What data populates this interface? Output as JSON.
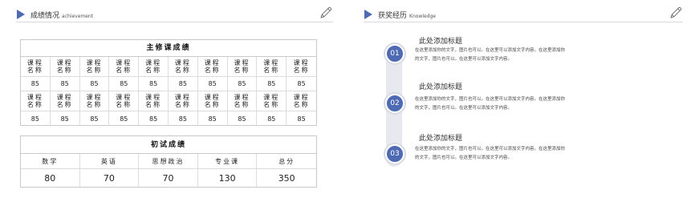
{
  "left": {
    "header": {
      "title": "成绩情况",
      "subtitle": "achievement",
      "icon": "pen-icon"
    },
    "major_table": {
      "title": "主修课成绩",
      "header_row_1": [
        "课程\n名称",
        "课程\n名称",
        "课程\n名称",
        "课程\n名称",
        "课程\n名称",
        "课程\n名称",
        "课程\n名称",
        "课程\n名称",
        "课程\n名称",
        "课程\n名称"
      ],
      "score_row_1": [
        "85",
        "85",
        "85",
        "85",
        "85",
        "85",
        "85",
        "85",
        "85",
        "85"
      ],
      "header_row_2": [
        "课程\n名称",
        "课程\n名称",
        "课程\n名称",
        "课程\n名称",
        "课程\n名称",
        "课程\n名称",
        "课程\n名称",
        "课程\n名称",
        "课程\n名称",
        "课程\n名称"
      ],
      "score_row_2": [
        "85",
        "85",
        "85",
        "85",
        "85",
        "85",
        "85",
        "85",
        "85",
        "85"
      ]
    },
    "exam_table": {
      "title": "初试成绩",
      "headers": [
        "数学",
        "英语",
        "思想政治",
        "专业课",
        "总分"
      ],
      "scores": [
        "80",
        "70",
        "70",
        "130",
        "350"
      ]
    }
  },
  "right": {
    "header": {
      "title": "获奖经历",
      "subtitle": "Knowledge",
      "icon": "pen-icon"
    },
    "items": [
      {
        "number": "01",
        "title": "此处添加标题",
        "line1": "在这里添加你的文字，图片也可以。在这里可以添加文字内容。在这里添加你",
        "line2": "的文字，图片也可以。在这里可以添加文字内容。"
      },
      {
        "number": "02",
        "title": "此处添加标题",
        "line1": "在这里添加你的文字，图片也可以。在这里可以添加文字内容。在这里添加你",
        "line2": "的文字，图片也可以。在这里可以添加文字内容。"
      },
      {
        "number": "03",
        "title": "此处添加标题",
        "line1": "在这里添加你的文字，图片也可以。在这里可以添加文字内容。在这里添加你",
        "line2": "的文字，图片也可以。在这里可以添加文字内容。"
      }
    ]
  },
  "colors": {
    "accent": "#4e6ab3",
    "track": "#e8e9ee",
    "border": "#c9c9c9"
  }
}
